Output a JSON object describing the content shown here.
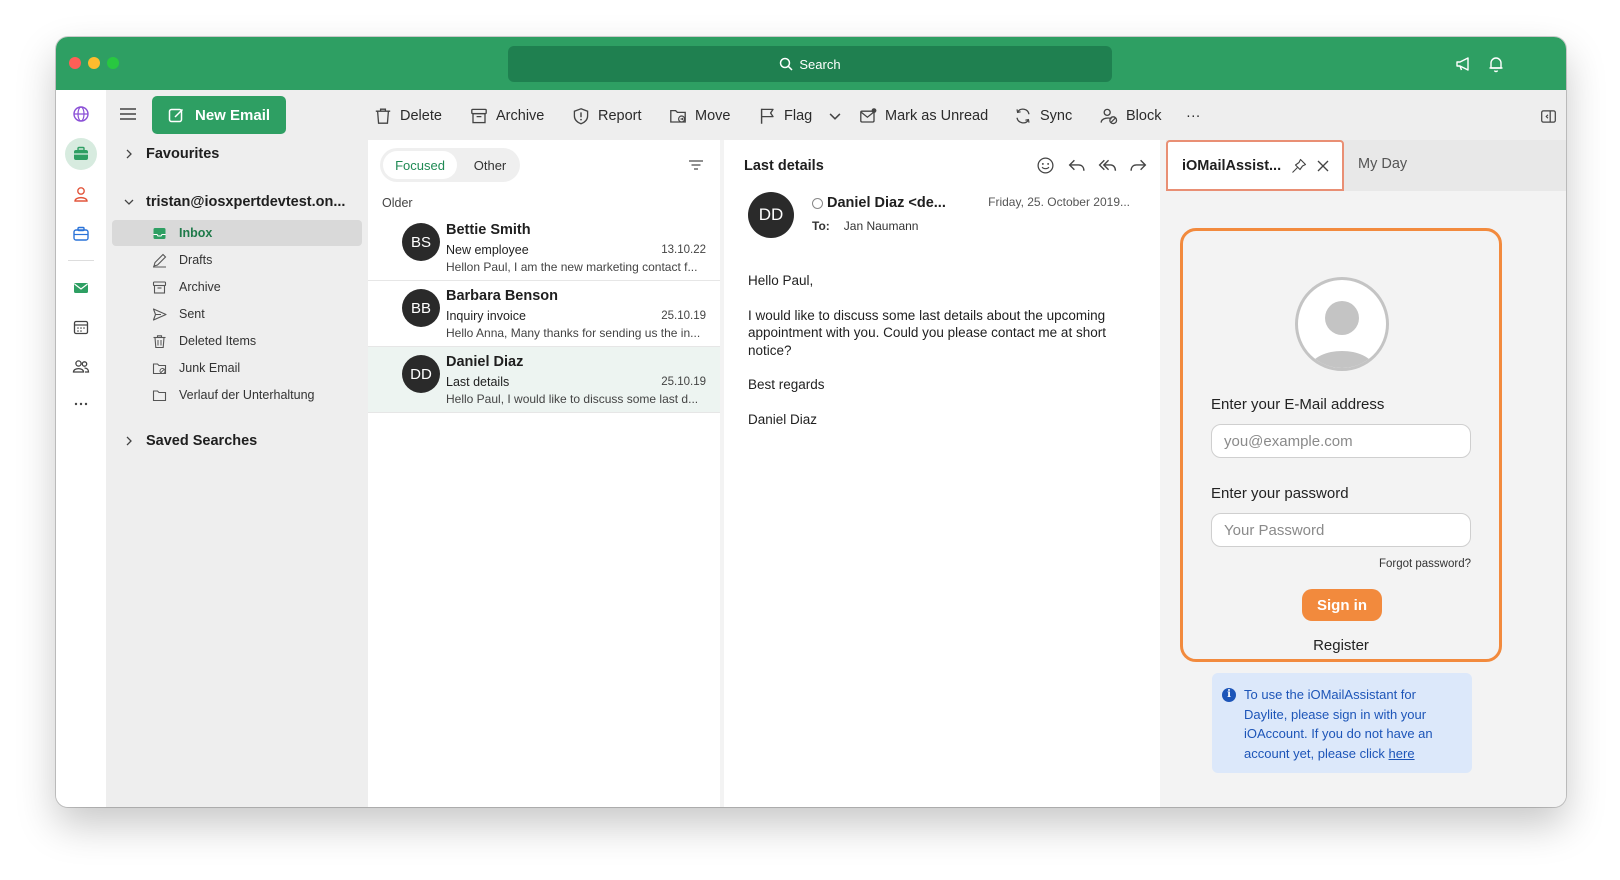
{
  "titlebar": {
    "search_label": "Search"
  },
  "rail": {
    "icons": [
      "globe-icon",
      "briefcase-icon",
      "contact-icon",
      "toolbox-icon",
      "mail-icon",
      "calendar-icon",
      "people-icon",
      "more-icon"
    ]
  },
  "sidebar": {
    "new_email_label": "New Email",
    "favourites_label": "Favourites",
    "account_label": "tristan@iosxpertdevtest.on...",
    "folders": [
      {
        "label": "Inbox",
        "icon": "inbox-icon"
      },
      {
        "label": "Drafts",
        "icon": "drafts-icon"
      },
      {
        "label": "Archive",
        "icon": "archive-icon"
      },
      {
        "label": "Sent",
        "icon": "sent-icon"
      },
      {
        "label": "Deleted Items",
        "icon": "trash-icon"
      },
      {
        "label": "Junk Email",
        "icon": "junk-icon"
      },
      {
        "label": "Verlauf der Unterhaltung",
        "icon": "folder-icon"
      }
    ],
    "saved_searches_label": "Saved Searches"
  },
  "toolbar": {
    "delete": "Delete",
    "archive": "Archive",
    "report": "Report",
    "move": "Move",
    "flag": "Flag",
    "mark_unread": "Mark as Unread",
    "sync": "Sync",
    "block": "Block",
    "more": "···"
  },
  "list": {
    "focused_tab": "Focused",
    "other_tab": "Other",
    "group_label": "Older",
    "messages": [
      {
        "initials": "BS",
        "sender": "Bettie Smith",
        "subject": "New employee",
        "date": "13.10.22",
        "preview": "Hellon Paul, I am the new marketing contact f..."
      },
      {
        "initials": "BB",
        "sender": "Barbara Benson",
        "subject": "Inquiry invoice",
        "date": "25.10.19",
        "preview": "Hello Anna, Many thanks for sending us the in..."
      },
      {
        "initials": "DD",
        "sender": "Daniel Diaz",
        "subject": "Last details",
        "date": "25.10.19",
        "preview": "Hello Paul, I would like to discuss some last d..."
      }
    ]
  },
  "reading": {
    "subject": "Last details",
    "avatar_initials": "DD",
    "from": "Daniel Diaz <de...",
    "date": "Friday, 25. October 2019...",
    "to_label": "To:",
    "to_value": "Jan Naumann",
    "body": [
      "Hello Paul,",
      "I would like to discuss some last details about the upcoming appointment with you. Could you please contact me at short notice?",
      "Best regards",
      "Daniel Diaz"
    ]
  },
  "addin": {
    "tab_label": "iOMailAssist...",
    "myday_label": "My Day",
    "email_label": "Enter your E-Mail address",
    "email_placeholder": "you@example.com",
    "password_label": "Enter your password",
    "password_placeholder": "Your Password",
    "forgot_label": "Forgot password?",
    "signin_label": "Sign in",
    "register_label": "Register",
    "info_text": "To use the iOMailAssistant for Daylite, please sign in with your iOAccount. If you do not have an account yet, please click ",
    "info_link": "here"
  },
  "colors": {
    "brand_green": "#2e9f63",
    "accent_orange": "#f28a3d",
    "info_blue": "#1d55b8"
  }
}
